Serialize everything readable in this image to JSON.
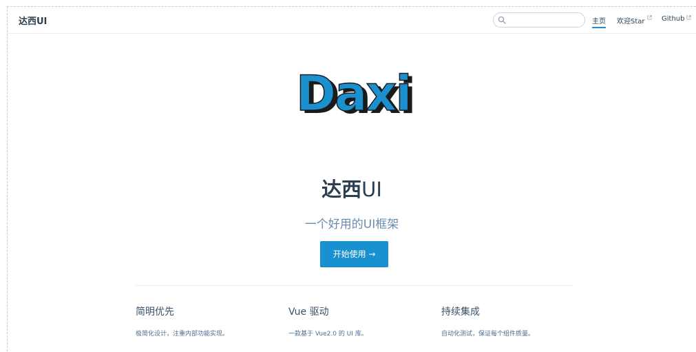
{
  "navbar": {
    "brand": "达西UI",
    "search_value": "",
    "links": [
      {
        "label": "主页",
        "active": true,
        "external": false
      },
      {
        "label": "欢迎Star",
        "active": false,
        "external": true
      },
      {
        "label": "Github",
        "active": false,
        "external": true
      }
    ]
  },
  "hero": {
    "logo_text": "Daxi",
    "title_bold": "达西",
    "title_light": "UI",
    "description": "一个好用的UI框架",
    "action_label": "开始使用 →"
  },
  "features": [
    {
      "title": "简明优先",
      "details": "极简化设计，注重内部功能实现。"
    },
    {
      "title": "Vue 驱动",
      "details": "一款基于 Vue2.0 的 UI 库。"
    },
    {
      "title": "持续集成",
      "details": "自动化测试，保证每个组件质量。"
    }
  ],
  "colors": {
    "accent": "#1991d0",
    "text": "#2c3e50",
    "muted": "#6a8bad"
  }
}
